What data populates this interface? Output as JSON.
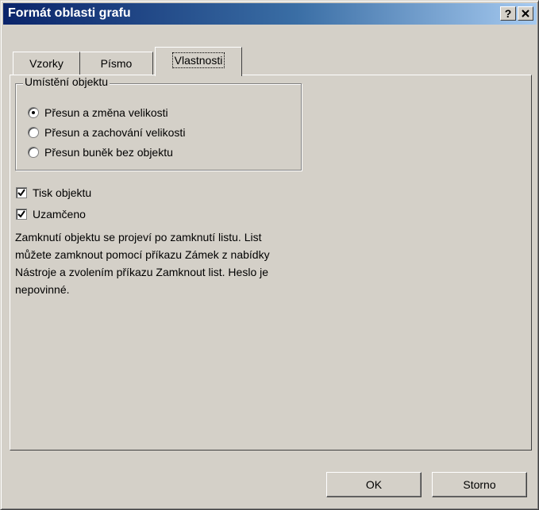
{
  "window": {
    "title": "Formát oblasti grafu",
    "help_label": "?",
    "close_label": "✕"
  },
  "tabs": [
    {
      "label": "Vzorky",
      "active": false
    },
    {
      "label": "Písmo",
      "active": false
    },
    {
      "label": "Vlastnosti",
      "active": true
    }
  ],
  "placement": {
    "legend": "Umístění objektu",
    "options": [
      {
        "label": "Přesun a změna velikosti",
        "selected": true
      },
      {
        "label": "Přesun a zachování velikosti",
        "selected": false
      },
      {
        "label": "Přesun buněk bez objektu",
        "selected": false
      }
    ]
  },
  "checkboxes": [
    {
      "label": "Tisk objektu",
      "checked": true
    },
    {
      "label": "Uzamčeno",
      "checked": true
    }
  ],
  "description": [
    "Zamknutí objektu se projeví po zamknutí listu. List",
    "můžete zamknout pomocí příkazu Zámek z nabídky",
    "Nástroje a zvolením příkazu Zamknout list. Heslo je",
    "nepovinné."
  ],
  "buttons": {
    "ok": "OK",
    "cancel": "Storno"
  },
  "colors": {
    "face": "#d4d0c8",
    "title_start": "#0a246a",
    "title_end": "#a6caf0"
  }
}
